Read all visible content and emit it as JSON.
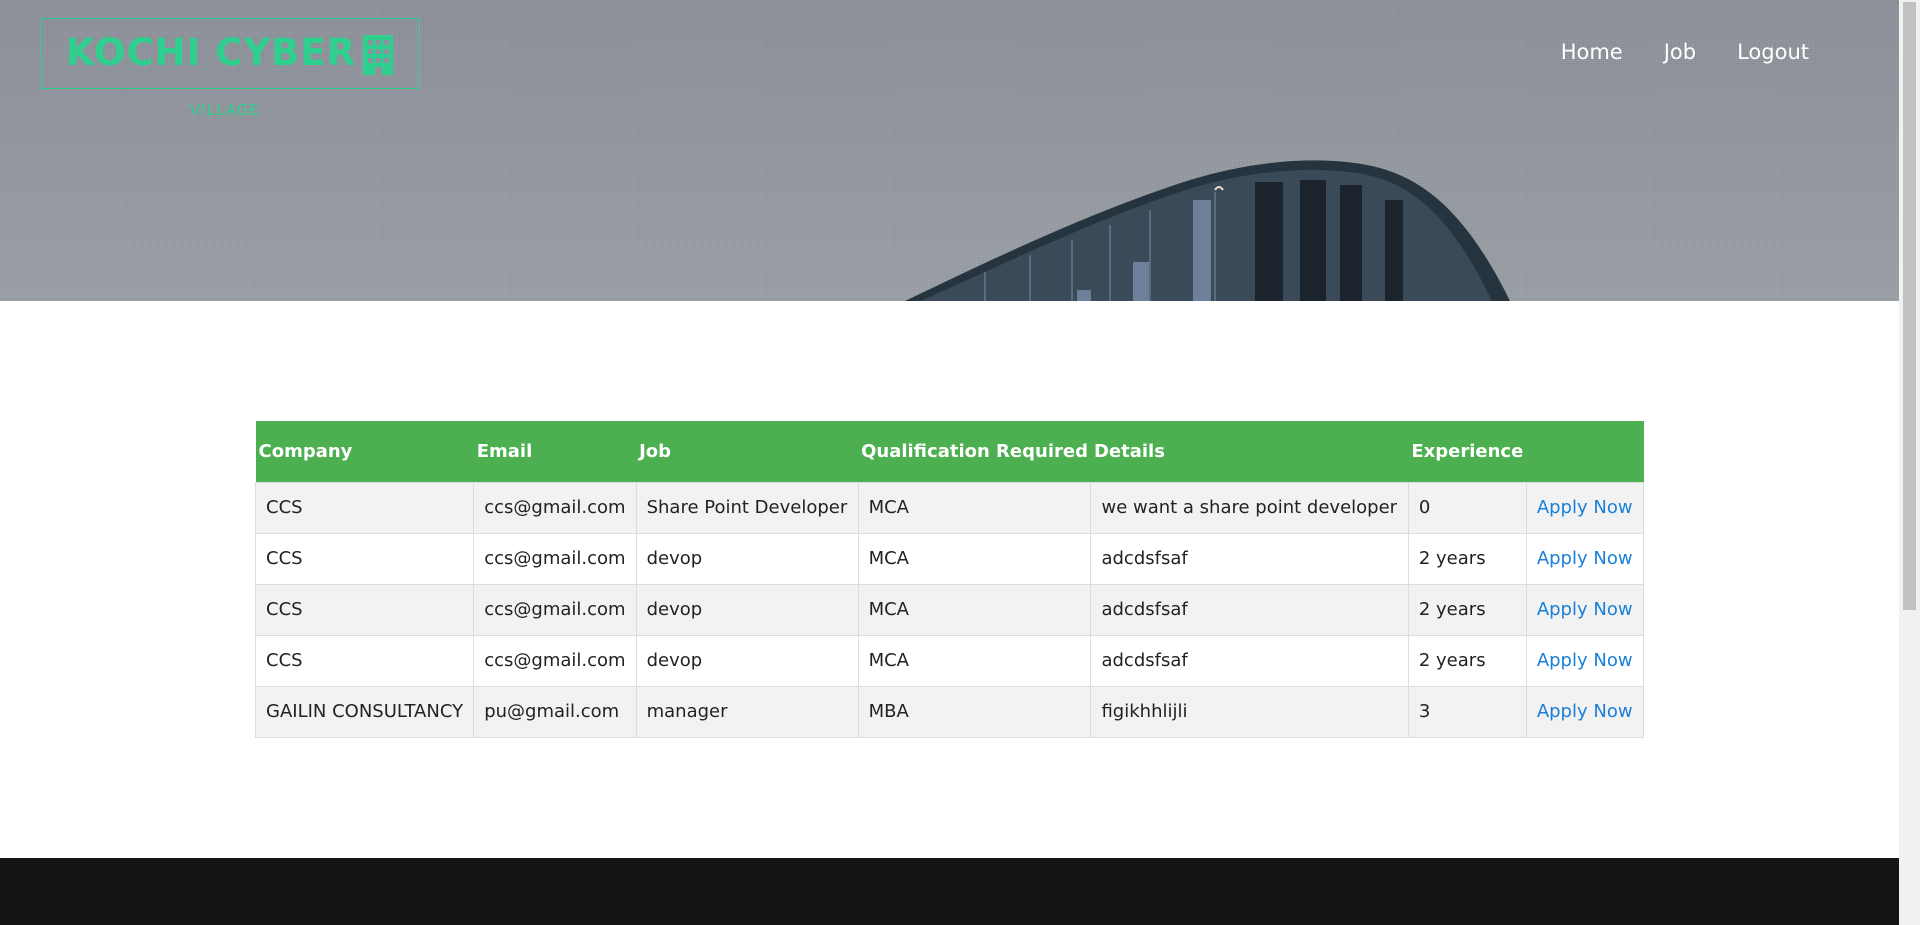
{
  "brand": {
    "name": "KOCHI CYBER",
    "sub": "VILLAGE",
    "icon": "building-icon",
    "color": "#2fd08f"
  },
  "nav": {
    "items": [
      {
        "label": "Home"
      },
      {
        "label": "Job"
      },
      {
        "label": "Logout"
      }
    ]
  },
  "table": {
    "headers": [
      "Company",
      "Email",
      "Job",
      "Qualification Required",
      "Details",
      "Experience",
      ""
    ],
    "header_color": "#4caf50",
    "rows": [
      {
        "company": "CCS",
        "email": "ccs@gmail.com",
        "job": "Share Point Developer",
        "qualification": "MCA",
        "details": "we want a share point developer",
        "experience": "0",
        "action": "Apply Now"
      },
      {
        "company": "CCS",
        "email": "ccs@gmail.com",
        "job": "devop",
        "qualification": "MCA",
        "details": "adcdsfsaf",
        "experience": "2 years",
        "action": "Apply Now"
      },
      {
        "company": "CCS",
        "email": "ccs@gmail.com",
        "job": "devop",
        "qualification": "MCA",
        "details": "adcdsfsaf",
        "experience": "2 years",
        "action": "Apply Now"
      },
      {
        "company": "CCS",
        "email": "ccs@gmail.com",
        "job": "devop",
        "qualification": "MCA",
        "details": "adcdsfsaf",
        "experience": "2 years",
        "action": "Apply Now"
      },
      {
        "company": "GAILIN CONSULTANCY",
        "email": "pu@gmail.com",
        "job": "manager",
        "qualification": "MBA",
        "details": "figikhhlijli",
        "experience": "3",
        "action": "Apply Now"
      }
    ]
  }
}
